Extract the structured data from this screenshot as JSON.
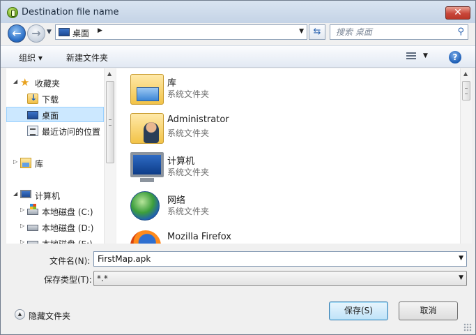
{
  "window": {
    "title": "Destination file name",
    "close_label": "✕"
  },
  "nav": {
    "back_icon": "back-arrow-icon",
    "forward_icon": "forward-arrow-icon",
    "address": {
      "crumb": "桌面"
    },
    "search_placeholder": "搜索 桌面"
  },
  "toolbar": {
    "organize_label": "组织 ▾",
    "new_folder_label": "新建文件夹",
    "help_label": "?"
  },
  "sidebar": {
    "items": [
      {
        "label": "收藏夹",
        "icon": "favorites-star-icon"
      },
      {
        "label": "下载",
        "icon": "downloads-folder-icon"
      },
      {
        "label": "桌面",
        "icon": "desktop-icon",
        "selected": true
      },
      {
        "label": "最近访问的位置",
        "icon": "recent-places-icon"
      },
      {
        "label": "库",
        "icon": "libraries-icon"
      },
      {
        "label": "计算机",
        "icon": "computer-icon"
      },
      {
        "label": "本地磁盘 (C:)",
        "icon": "system-drive-icon"
      },
      {
        "label": "本地磁盘 (D:)",
        "icon": "drive-icon"
      },
      {
        "label": "本地磁盘 (E:)",
        "icon": "drive-icon"
      }
    ]
  },
  "files": [
    {
      "name": "库",
      "type": "系统文件夹",
      "icon": "library-folder-icon"
    },
    {
      "name": "Administrator",
      "type": "系统文件夹",
      "icon": "user-folder-icon"
    },
    {
      "name": "计算机",
      "type": "系统文件夹",
      "icon": "computer-icon"
    },
    {
      "name": "网络",
      "type": "系统文件夹",
      "icon": "network-globe-icon"
    },
    {
      "name": "Mozilla Firefox",
      "type": "",
      "icon": "firefox-icon"
    }
  ],
  "form": {
    "filename_label": "文件名(N):",
    "filename_value": "FirstMap.apk",
    "filetype_label": "保存类型(T):",
    "filetype_value": "*.*"
  },
  "footer": {
    "hide_folders_label": "隐藏文件夹",
    "save_label": "保存(S)",
    "cancel_label": "取消"
  },
  "colors": {
    "selection": "#cce8ff",
    "titlebar": "#c4d3e6",
    "close": "#c9473a"
  }
}
